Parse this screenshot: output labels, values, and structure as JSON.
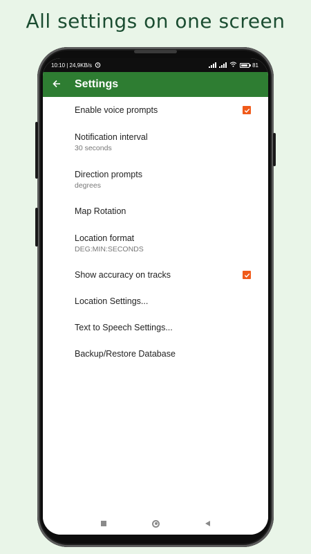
{
  "promo": {
    "title": "All settings on one screen"
  },
  "status_bar": {
    "time_and_speed": "10:10 | 24,9KB/s",
    "battery": "81"
  },
  "app_bar": {
    "title": "Settings"
  },
  "settings": [
    {
      "title": "Enable voice prompts",
      "summary": "",
      "checked": true
    },
    {
      "title": "Notification interval",
      "summary": "30 seconds"
    },
    {
      "title": "Direction prompts",
      "summary": "degrees"
    },
    {
      "title": "Map Rotation",
      "summary": ""
    },
    {
      "title": "Location format",
      "summary": "DEG:MIN:SECONDS"
    },
    {
      "title": "Show accuracy on tracks",
      "summary": "",
      "checked": true
    },
    {
      "title": "Location Settings...",
      "summary": ""
    },
    {
      "title": "Text to Speech Settings...",
      "summary": ""
    },
    {
      "title": "Backup/Restore Database",
      "summary": ""
    }
  ],
  "icons": {
    "back": "arrow-left-icon",
    "alarm": "alarm-clock-icon",
    "signal": "cell-signal-icon",
    "wifi": "wifi-icon",
    "battery": "battery-icon",
    "nav_recents": "square-icon",
    "nav_home": "circle-icon",
    "nav_back": "triangle-back-icon"
  },
  "colors": {
    "app_bar": "#2e7d32",
    "checkbox": "#f05a1a",
    "promo_text": "#1b4d31",
    "background": "#e9f5e8"
  }
}
